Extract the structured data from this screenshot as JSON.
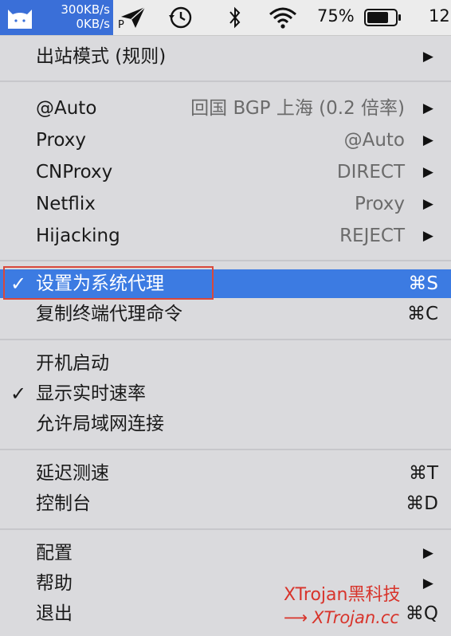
{
  "menubar": {
    "upload_speed": "300KB/s",
    "download_speed": "0KB/s",
    "battery_percent": "75%",
    "clock_partial": "12",
    "icons": [
      "clash-cat-icon",
      "paper-plane-icon",
      "time-machine-icon",
      "bluetooth-icon",
      "wifi-icon",
      "battery-icon"
    ],
    "paper_plane_letter": "P",
    "accent_color": "#3a6fd8"
  },
  "menu": {
    "outbound_mode": {
      "label": "出站模式 (规则)"
    },
    "proxy_groups": [
      {
        "label": "@Auto",
        "value": "回国 BGP 上海 (0.2 倍率)"
      },
      {
        "label": "Proxy",
        "value": "@Auto"
      },
      {
        "label": "CNProxy",
        "value": "DIRECT"
      },
      {
        "label": "Netflix",
        "value": "Proxy"
      },
      {
        "label": "Hijacking",
        "value": "REJECT"
      }
    ],
    "system_proxy": {
      "label": "设置为系统代理",
      "shortcut": "⌘S",
      "checked": true
    },
    "copy_terminal": {
      "label": "复制终端代理命令",
      "shortcut": "⌘C"
    },
    "launch_at_login": {
      "label": "开机启动"
    },
    "show_speed": {
      "label": "显示实时速率",
      "checked": true
    },
    "allow_lan": {
      "label": "允许局域网连接"
    },
    "latency_test": {
      "label": "延迟测速",
      "shortcut": "⌘T"
    },
    "dashboard": {
      "label": "控制台",
      "shortcut": "⌘D"
    },
    "config": {
      "label": "配置"
    },
    "help": {
      "label": "帮助"
    },
    "quit": {
      "label": "退出",
      "shortcut": "⌘Q"
    },
    "check_glyph": "✓",
    "submenu_arrow": "▶",
    "highlight_color": "#3c7be2"
  },
  "watermark": {
    "line1": "XTrojan黑科技",
    "line2": "XTrojan.cc",
    "arrow": "⟶",
    "color": "#d8342b"
  }
}
